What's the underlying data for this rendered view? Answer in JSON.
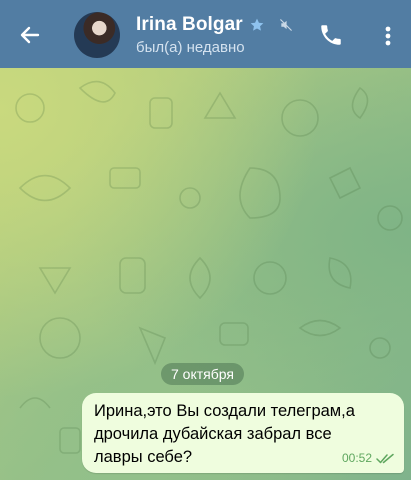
{
  "header": {
    "contact_name": "Irina Bolgar",
    "status": "был(а) недавно",
    "icons": {
      "back": "arrow-left-icon",
      "star": "star-icon",
      "mute": "muted-icon",
      "call": "phone-icon",
      "menu": "more-vertical-icon"
    }
  },
  "chat": {
    "date_label": "7 октября",
    "messages": [
      {
        "text": "Ирина,это Вы создали телеграм,а\nдрочила дубайская забрал все\nлавры себе?",
        "time": "00:52",
        "read": true,
        "outgoing": true
      }
    ]
  },
  "colors": {
    "header_bg": "#527da3",
    "bubble_out": "#effdde",
    "check_color": "#5fa75f",
    "star_color": "#8fc3ef"
  }
}
